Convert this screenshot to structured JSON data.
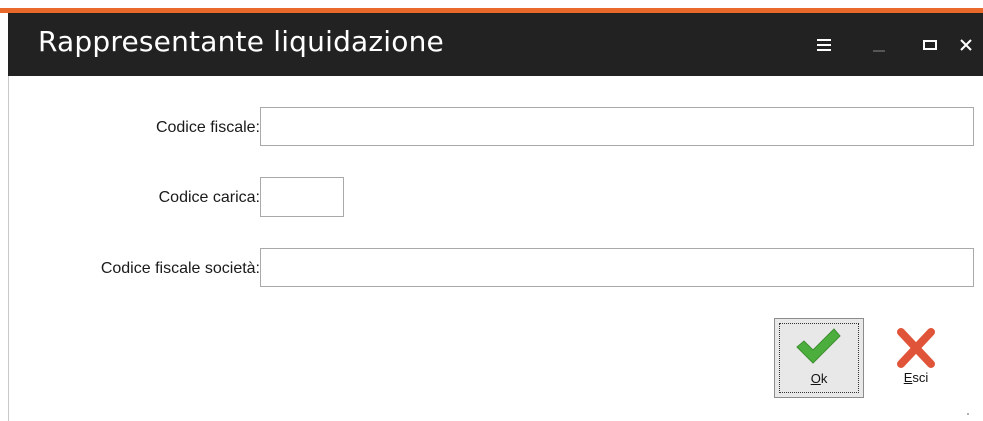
{
  "window": {
    "title": "Rappresentante liquidazione"
  },
  "colors": {
    "accent": "#e8692a",
    "titlebar": "#222222",
    "ok_icon": "#4caf3d",
    "esci_icon": "#e0553a"
  },
  "titlebar_icons": [
    "menu-icon",
    "minimize-icon",
    "maximize-icon",
    "close-icon"
  ],
  "form": {
    "codice_fiscale": {
      "label": "Codice fiscale:",
      "value": ""
    },
    "codice_carica": {
      "label": "Codice carica:",
      "value": ""
    },
    "codice_fiscale_societa": {
      "label": "Codice fiscale società:",
      "value": ""
    }
  },
  "buttons": {
    "ok": {
      "accel": "O",
      "rest": "k",
      "icon": "checkmark-icon"
    },
    "esci": {
      "accel": "E",
      "rest": "sci",
      "icon": "x-cross-icon"
    }
  }
}
